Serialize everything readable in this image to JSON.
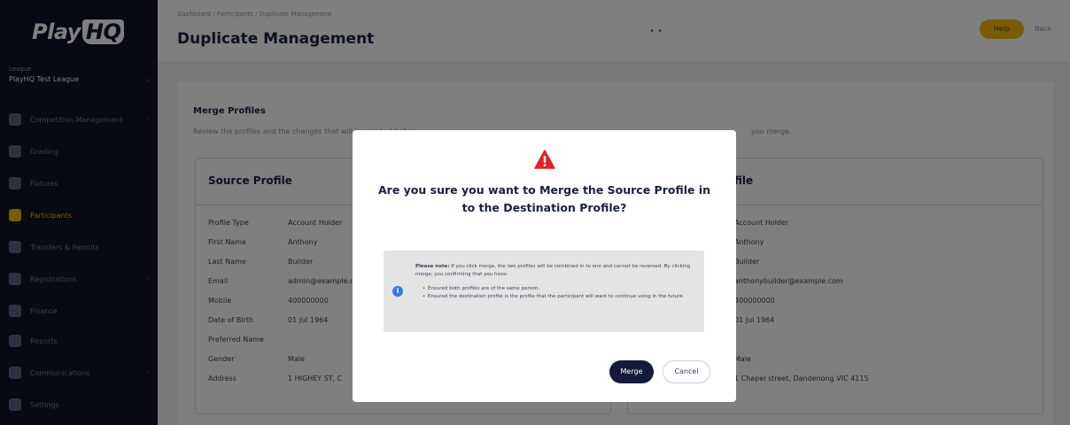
{
  "brand": {
    "logo_text": "Play",
    "logo_badge": "HQ"
  },
  "sidebar": {
    "org_label": "League",
    "org_name": "PlayHQ Test League",
    "items": [
      {
        "label": "Competition Management",
        "icon": "trophy-icon",
        "has_chevron": true
      },
      {
        "label": "Grading",
        "icon": "star-icon",
        "has_chevron": false
      },
      {
        "label": "Fixtures",
        "icon": "calendar-icon",
        "has_chevron": false
      },
      {
        "label": "Participants",
        "icon": "people-icon",
        "has_chevron": false,
        "active": true
      },
      {
        "label": "Transfers & Permits",
        "icon": "transfer-icon",
        "has_chevron": false
      },
      {
        "label": "Registrations",
        "icon": "clipboard-icon",
        "has_chevron": true
      },
      {
        "label": "Finance",
        "icon": "money-icon",
        "has_chevron": false
      },
      {
        "label": "Reports",
        "icon": "report-icon",
        "has_chevron": false
      },
      {
        "label": "Communications",
        "icon": "chat-icon",
        "has_chevron": true
      },
      {
        "label": "Settings",
        "icon": "gear-icon",
        "has_chevron": false
      }
    ]
  },
  "header": {
    "breadcrumb": "Dashboard  /  Participants  /  Duplicate Management",
    "title": "Duplicate Management",
    "menu_dots": "• •",
    "cta_label": "Help",
    "link_label": "Back"
  },
  "main": {
    "merge_title": "Merge Profiles",
    "merge_desc": "Review the profiles and the changes that will be applied before",
    "merge_desc_right": "you merge.",
    "source": {
      "title": "Source Profile",
      "rows": [
        {
          "label": "Profile Type",
          "value": "Account Holder"
        },
        {
          "label": "First Name",
          "value": "Anthony"
        },
        {
          "label": "Last Name",
          "value": "Builder"
        },
        {
          "label": "Email",
          "value": "admin@example.com"
        },
        {
          "label": "Mobile",
          "value": "400000000"
        },
        {
          "label": "Date of Birth",
          "value": "01 Jul 1964"
        },
        {
          "label": "Preferred Name",
          "value": ""
        },
        {
          "label": "Gender",
          "value": "Male"
        },
        {
          "label": "Address",
          "value": "1 HIGHEY ST, C"
        }
      ]
    },
    "dest": {
      "title": "Destination Profile",
      "title_partial": "file",
      "values": [
        "Account Holder",
        "Anthony",
        "Builder",
        "anthonybuilder@example.com",
        "400000000",
        "01 Jul 1964",
        "",
        "Male",
        "1 Chapel street, Dandenong VIC 4115"
      ]
    }
  },
  "modal": {
    "warning_icon": "warning-triangle-icon",
    "question_line1": "Are you sure you want to Merge the Source Profile in",
    "question_line2": "to the Destination Profile?",
    "note_prefix": "Please note:",
    "note_body": " If you click merge, the two profiles will be combined in to one and cannot be reversed. By clicking merge, you confirming that you have:",
    "note_item1": "Ensured both profiles are of the same person.",
    "note_item2": "Ensured the destination profile is the profile that the participant will want to continue using in the future.",
    "info_icon": "info-icon",
    "merge_label": "Merge",
    "cancel_label": "Cancel"
  },
  "colors": {
    "accent": "#f2b705",
    "sidebar": "#0e1326",
    "primary_button": "#151a3a",
    "warning": "#e02424",
    "info": "#2f7de1"
  }
}
